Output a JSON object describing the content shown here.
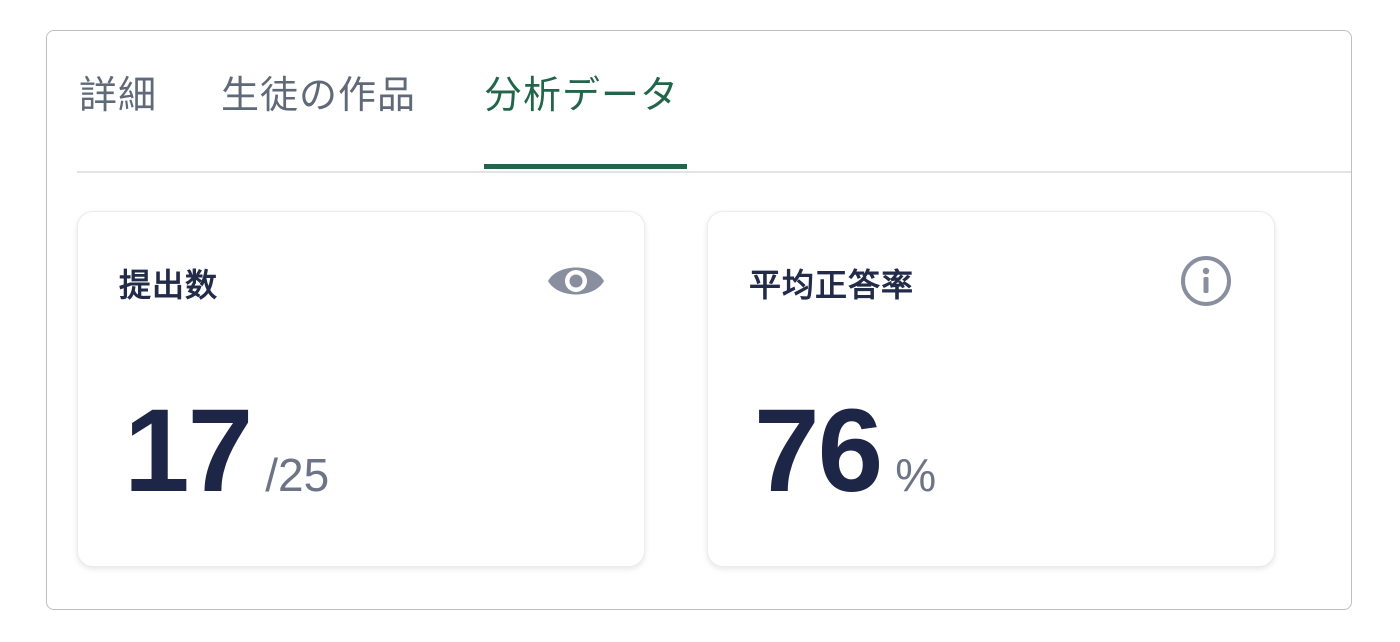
{
  "tabs": [
    {
      "label": "詳細"
    },
    {
      "label": "生徒の作品"
    },
    {
      "label": "分析データ",
      "active": true
    }
  ],
  "cards": [
    {
      "title": "提出数",
      "value": "17",
      "suffix": "/25",
      "icon": "eye-icon"
    },
    {
      "title": "平均正答率",
      "value": "76",
      "suffix": "%",
      "icon": "info-icon"
    }
  ],
  "colors": {
    "active_tab": "#23654a",
    "inactive_tab": "#5f6978",
    "title_text": "#222b48",
    "value_text": "#1d2646",
    "icon": "#8a8f9f"
  }
}
